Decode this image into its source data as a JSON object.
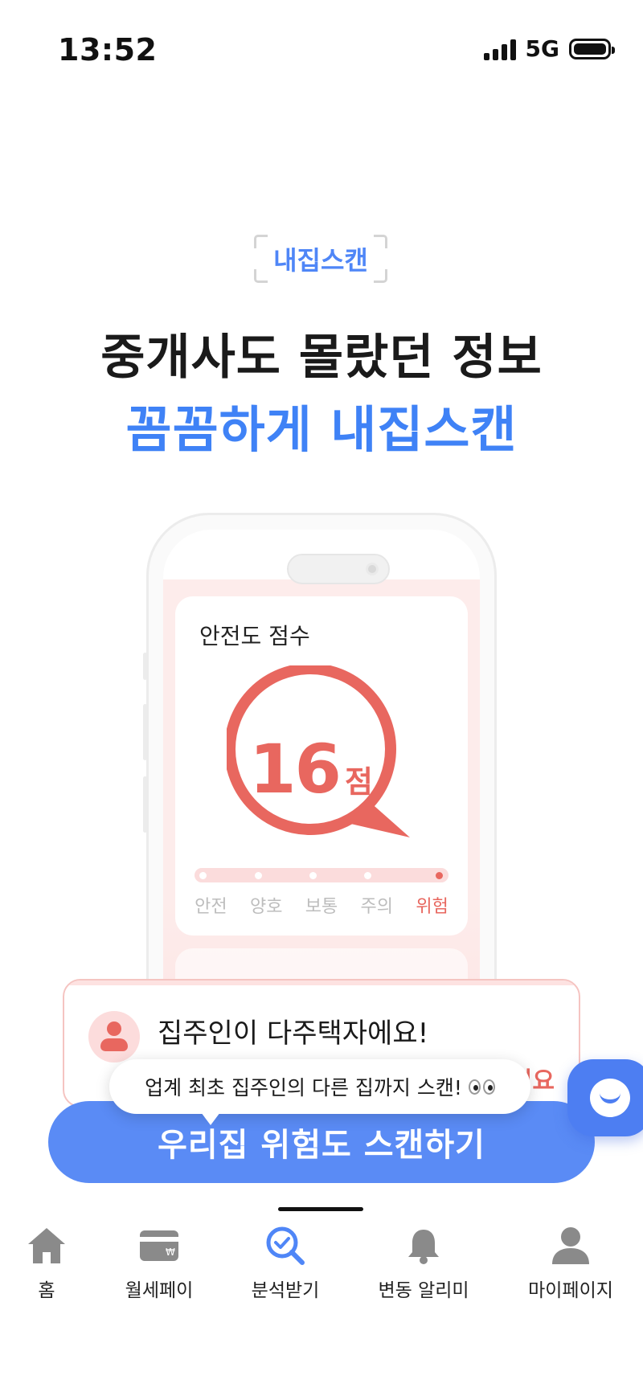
{
  "status_bar": {
    "time": "13:52",
    "network": "5G"
  },
  "hero": {
    "tag": "내집스캔",
    "headline_line1": "중개사도 몰랐던 정보",
    "headline_line2": "꼼꼼하게 내집스캔"
  },
  "score_card": {
    "title": "안전도 점수",
    "score": "16",
    "unit": "점",
    "levels": [
      "안전",
      "양호",
      "보통",
      "주의",
      "위험"
    ],
    "active_level": "위험",
    "accent": "#e8675f"
  },
  "alert_card": {
    "title": "집주인이 다주택자에요!",
    "tail_text": "이요"
  },
  "tooltip": {
    "text": "업계 최초 집주인의 다른 집까지 스캔!"
  },
  "cta": {
    "label": "우리집 위험도 스캔하기",
    "color": "#5a8bf5"
  },
  "chat_button": {
    "icon": "chat-smile-icon"
  },
  "tabbar": {
    "items": [
      {
        "label": "홈",
        "icon": "home-icon"
      },
      {
        "label": "월세페이",
        "icon": "card-icon"
      },
      {
        "label": "분석받기",
        "icon": "search-check-icon",
        "active": true
      },
      {
        "label": "변동 알리미",
        "icon": "bell-icon"
      },
      {
        "label": "마이페이지",
        "icon": "person-icon"
      }
    ],
    "active_color": "#4f86f7"
  }
}
